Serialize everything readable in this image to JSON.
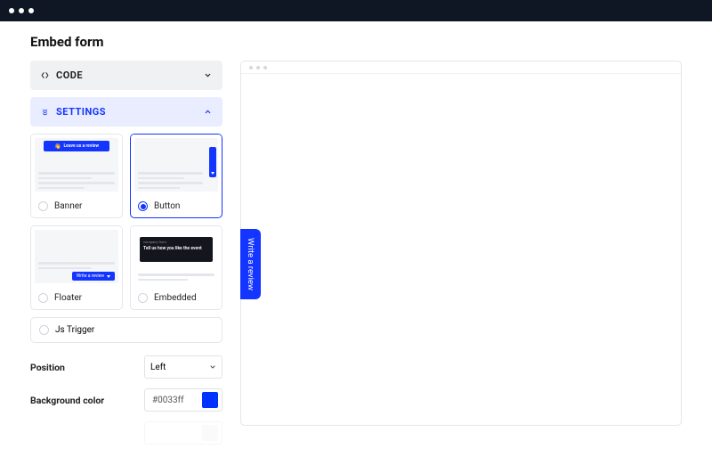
{
  "page_title": "Embed form",
  "accordion": {
    "code_label": "CODE",
    "settings_label": "SETTINGS"
  },
  "display_options": {
    "banner": "Banner",
    "button": "Button",
    "floater": "Floater",
    "embedded": "Embedded",
    "js_trigger": "Js Trigger",
    "selected": "button"
  },
  "thumb": {
    "banner_text": "Leave us a review",
    "floater_text": "Write a review",
    "embed_p": "company from",
    "embed_h": "Tell us how you like the event"
  },
  "settings": {
    "position_label": "Position",
    "position_value": "Left",
    "bg_label": "Background color",
    "bg_value": "#0033ff"
  },
  "preview": {
    "button_text": "Write a review"
  },
  "colors": {
    "accent": "#1435ff"
  }
}
